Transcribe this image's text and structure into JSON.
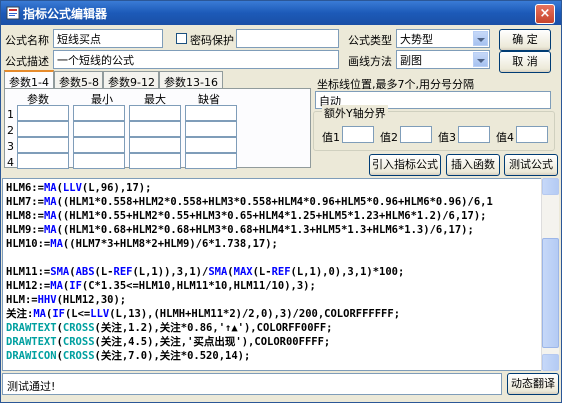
{
  "window": {
    "title": "指标公式编辑器",
    "close_label": "×"
  },
  "formula_name": {
    "label": "公式名称",
    "value": "短线买点"
  },
  "password": {
    "label": "密码保护",
    "checked": false
  },
  "formula_desc": {
    "label": "公式描述",
    "value": "一个短线的公式"
  },
  "formula_type": {
    "label": "公式类型",
    "value": "大势型"
  },
  "draw_method": {
    "label": "画线方法",
    "value": "副图"
  },
  "buttons": {
    "ok": "确 定",
    "cancel": "取 消",
    "import": "引入指标公式",
    "insert_func": "插入函数",
    "test": "测试公式",
    "translate": "动态翻译"
  },
  "tabs": [
    "参数1-4",
    "参数5-8",
    "参数9-12",
    "参数13-16"
  ],
  "param_table": {
    "headers": [
      "参数",
      "最小",
      "最大",
      "缺省"
    ],
    "rows": [
      "1",
      "2",
      "3",
      "4"
    ]
  },
  "coord": {
    "label": "坐标线位置,最多7个,用分号分隔",
    "value": "自动"
  },
  "extra_axis": {
    "title": "额外Y轴分界",
    "labels": [
      "值1",
      "值2",
      "值3",
      "值4"
    ]
  },
  "code_lines": [
    [
      {
        "t": "HLM6:=",
        "c": "blk"
      },
      {
        "t": "MA",
        "c": "blu"
      },
      {
        "t": "(",
        "c": "blk"
      },
      {
        "t": "LLV",
        "c": "blu"
      },
      {
        "t": "(L,96),17);",
        "c": "blk"
      }
    ],
    [
      {
        "t": "HLM7:=",
        "c": "blk"
      },
      {
        "t": "MA",
        "c": "blu"
      },
      {
        "t": "((HLM1*0.558+HLM2*0.558+HLM3*0.558+HLM4*0.96+HLM5*0.96+HLM6*0.96)/6,1",
        "c": "blk"
      }
    ],
    [
      {
        "t": "HLM8:=",
        "c": "blk"
      },
      {
        "t": "MA",
        "c": "blu"
      },
      {
        "t": "((HLM1*0.55+HLM2*0.55+HLM3*0.65+HLM4*1.25+HLM5*1.23+HLM6*1.2)/6,17);",
        "c": "blk"
      }
    ],
    [
      {
        "t": "HLM9:=",
        "c": "blk"
      },
      {
        "t": "MA",
        "c": "blu"
      },
      {
        "t": "((HLM1*0.68+HLM2*0.68+HLM3*0.68+HLM4*1.3+HLM5*1.3+HLM6*1.3)/6,17);",
        "c": "blk"
      }
    ],
    [
      {
        "t": "HLM10:=",
        "c": "blk"
      },
      {
        "t": "MA",
        "c": "blu"
      },
      {
        "t": "((HLM7*3+HLM8*2+HLM9)/6*1.738,17);",
        "c": "blk"
      }
    ],
    [],
    [
      {
        "t": "HLM11:=",
        "c": "blk"
      },
      {
        "t": "SMA",
        "c": "blu"
      },
      {
        "t": "(",
        "c": "blk"
      },
      {
        "t": "ABS",
        "c": "blu"
      },
      {
        "t": "(L-",
        "c": "blk"
      },
      {
        "t": "REF",
        "c": "blu"
      },
      {
        "t": "(L,1)),3,1)/",
        "c": "blk"
      },
      {
        "t": "SMA",
        "c": "blu"
      },
      {
        "t": "(",
        "c": "blk"
      },
      {
        "t": "MAX",
        "c": "blu"
      },
      {
        "t": "(L-",
        "c": "blk"
      },
      {
        "t": "REF",
        "c": "blu"
      },
      {
        "t": "(L,1),0),3,1)*100;",
        "c": "blk"
      }
    ],
    [
      {
        "t": "HLM12:=",
        "c": "blk"
      },
      {
        "t": "MA",
        "c": "blu"
      },
      {
        "t": "(",
        "c": "blk"
      },
      {
        "t": "IF",
        "c": "blu"
      },
      {
        "t": "(C*1.35<=HLM10,HLM11*10,HLM11/10),3);",
        "c": "blk"
      }
    ],
    [
      {
        "t": "HLM:=",
        "c": "blk"
      },
      {
        "t": "HHV",
        "c": "blu"
      },
      {
        "t": "(HLM12,30);",
        "c": "blk"
      }
    ],
    [
      {
        "t": "关注:",
        "c": "blk"
      },
      {
        "t": "MA",
        "c": "blu"
      },
      {
        "t": "(",
        "c": "blk"
      },
      {
        "t": "IF",
        "c": "blu"
      },
      {
        "t": "(L<=",
        "c": "blk"
      },
      {
        "t": "LLV",
        "c": "blu"
      },
      {
        "t": "(L,13),(HLMH+HLM11*2)/2,0),3)/200,COLORFFFFFF;",
        "c": "blk"
      }
    ],
    [
      {
        "t": "DRAWTEXT",
        "c": "cyn"
      },
      {
        "t": "(",
        "c": "blk"
      },
      {
        "t": "CROSS",
        "c": "cyn"
      },
      {
        "t": "(关注,1.2),关注*0.86,'↑▲'),COLORFF00FF;",
        "c": "blk"
      }
    ],
    [
      {
        "t": "DRAWTEXT",
        "c": "cyn"
      },
      {
        "t": "(",
        "c": "blk"
      },
      {
        "t": "CROSS",
        "c": "cyn"
      },
      {
        "t": "(关注,4.5),关注,'买点出现'),COLOR00FFFF;",
        "c": "blk"
      }
    ],
    [
      {
        "t": "DRAWICON",
        "c": "cyn"
      },
      {
        "t": "(",
        "c": "blk"
      },
      {
        "t": "CROSS",
        "c": "cyn"
      },
      {
        "t": "(关注,7.0),关注*0.520,14);",
        "c": "blk"
      }
    ]
  ],
  "status": {
    "text": "测试通过!"
  }
}
